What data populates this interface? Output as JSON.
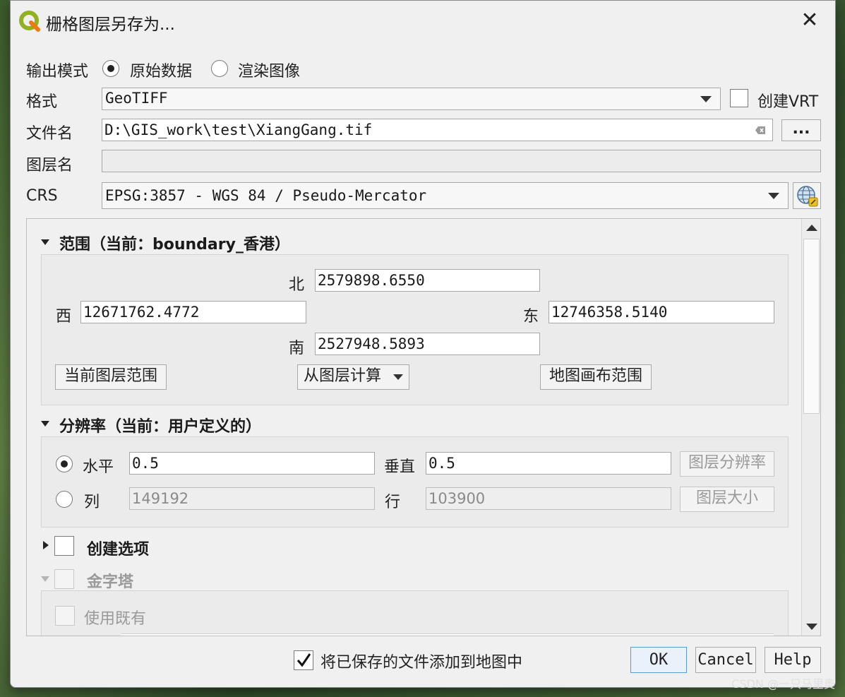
{
  "window": {
    "title": "栅格图层另存为..."
  },
  "output_mode": {
    "label": "输出模式",
    "option_raw": "原始数据",
    "option_rendered": "渲染图像",
    "selected": "原始数据"
  },
  "format": {
    "label": "格式",
    "value": "GeoTIFF",
    "create_vrt_label": "创建VRT"
  },
  "filename": {
    "label": "文件名",
    "value": "D:\\GIS_work\\test\\XiangGang.tif",
    "browse_label": "..."
  },
  "layer_name": {
    "label": "图层名",
    "value": ""
  },
  "crs": {
    "label": "CRS",
    "value": "EPSG:3857 - WGS 84 / Pseudo-Mercator"
  },
  "extent": {
    "title": "范围（当前：boundary_香港）",
    "north_label": "北",
    "north": "2579898.6550",
    "west_label": "西",
    "west": "12671762.4772",
    "east_label": "东",
    "east": "12746358.5140",
    "south_label": "南",
    "south": "2527948.5893",
    "btn_current_layer": "当前图层范围",
    "btn_from_layer": "从图层计算",
    "btn_map_canvas": "地图画布范围"
  },
  "resolution": {
    "title": "分辨率（当前：用户定义的）",
    "horizontal_label": "水平",
    "horizontal": "0.5",
    "vertical_label": "垂直",
    "vertical": "0.5",
    "btn_layer_resolution": "图层分辨率",
    "columns_label": "列",
    "columns": "149192",
    "rows_label": "行",
    "rows": "103900",
    "btn_layer_size": "图层大小"
  },
  "create_options": {
    "title": "创建选项"
  },
  "pyramids": {
    "title": "金字塔",
    "use_existing": "使用既有"
  },
  "footer": {
    "add_to_map_label": "将已保存的文件添加到地图中",
    "ok": "OK",
    "cancel": "Cancel",
    "help": "Help"
  },
  "watermark": "CSDN @一只马里奥"
}
